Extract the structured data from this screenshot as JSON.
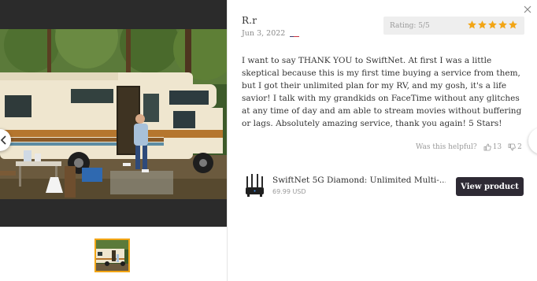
{
  "review": {
    "author": "R.r",
    "date": "Jun 3, 2022",
    "country_flag": "us-flag-icon",
    "rating_label": "Rating: 5/5",
    "rating_value": 5,
    "rating_max": 5,
    "star_color": "#f2a515",
    "body": "I want to say THANK YOU to SwiftNet. At first I was a little skeptical because this is my first time buying a service from them, but I got their unlimited plan for my RV, and my gosh, it's a life savior! I talk with my grandkids on FaceTime without any glitches at any time of day and am able to stream movies without buffering or lags. Absolutely amazing service, thank you again! 5 Stars!"
  },
  "helpful": {
    "question": "Was this helpful?",
    "up_count": "13",
    "down_count": "2"
  },
  "product": {
    "name": "SwiftNet 5G Diamond: Unlimited Multi-...",
    "price": "69.99 USD",
    "button_label": "View product",
    "button_color": "#2e2a34"
  },
  "media": {
    "active_thumbnail": 1,
    "thumbnail_border_color": "#f2a515"
  }
}
